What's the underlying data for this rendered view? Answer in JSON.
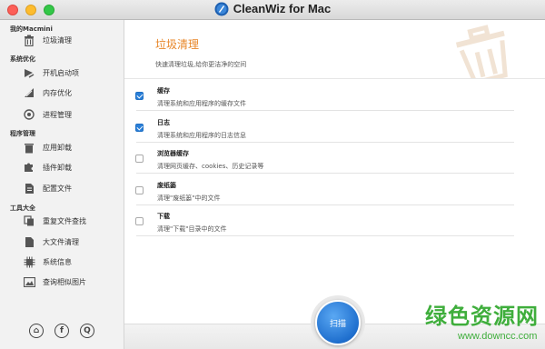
{
  "window": {
    "title": "CleanWiz for Mac"
  },
  "sidebar": {
    "sections": [
      {
        "title": "我的Macmini",
        "items": [
          {
            "label": "垃圾清理",
            "icon": "trash-icon"
          }
        ]
      },
      {
        "title": "系统优化",
        "items": [
          {
            "label": "开机启动项",
            "icon": "startup-arrow-icon"
          },
          {
            "label": "内存优化",
            "icon": "memory-gauge-icon"
          },
          {
            "label": "进程管理",
            "icon": "process-gear-icon"
          }
        ]
      },
      {
        "title": "程序管理",
        "items": [
          {
            "label": "应用卸载",
            "icon": "app-uninstall-icon"
          },
          {
            "label": "插件卸载",
            "icon": "plugin-puzzle-icon"
          },
          {
            "label": "配置文件",
            "icon": "config-file-icon"
          }
        ]
      },
      {
        "title": "工具大全",
        "items": [
          {
            "label": "重复文件查找",
            "icon": "duplicate-files-icon"
          },
          {
            "label": "大文件清理",
            "icon": "large-file-icon"
          },
          {
            "label": "系统信息",
            "icon": "system-info-chip-icon"
          },
          {
            "label": "查询相似图片",
            "icon": "similar-images-icon"
          }
        ]
      }
    ],
    "bottom_icons": [
      "home-icon",
      "facebook-icon",
      "qq-icon"
    ],
    "bottom_glyphs": {
      "home": "⌂",
      "facebook": "f",
      "qq": "Q"
    }
  },
  "main": {
    "title": "垃圾清理",
    "subtitle": "快速清理垃圾,给你更洁净的空间",
    "options": [
      {
        "title": "缓存",
        "desc": "清理系统和应用程序的缓存文件",
        "checked": true
      },
      {
        "title": "日志",
        "desc": "清理系统和应用程序的日志信息",
        "checked": true
      },
      {
        "title": "浏览器缓存",
        "desc": "清理网页缓存、cookies、历史记录等",
        "checked": false
      },
      {
        "title": "废纸篓",
        "desc": "清理\"废纸篓\"中的文件",
        "checked": false
      },
      {
        "title": "下载",
        "desc": "清理\"下载\"目录中的文件",
        "checked": false
      }
    ],
    "scan_label": "扫描"
  },
  "watermark": {
    "main": "绿色资源网",
    "url": "www.downcc.com"
  },
  "colors": {
    "accent_orange": "#e8872a",
    "accent_blue": "#2a7fd8",
    "watermark_green": "#3fae3c"
  }
}
